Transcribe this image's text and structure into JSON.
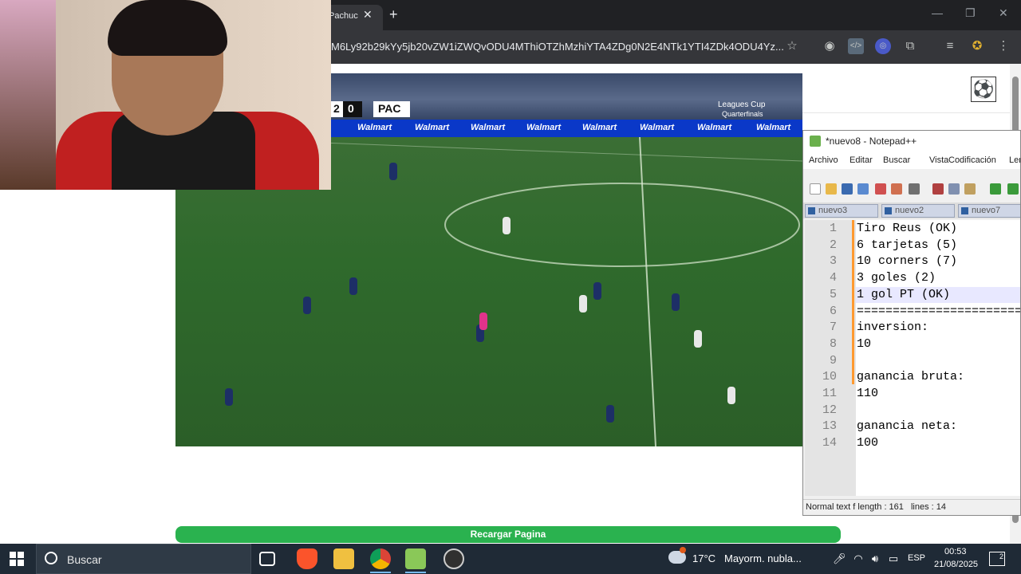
{
  "browser": {
    "tab_title": "Pachuc",
    "url": "M6Ly92b29kYy5jb20vZW1iZWQvODU4MThiOTZhMzhiYTA4ZDg0N2E4NTk1YTI4ZDk4ODU4Yz..."
  },
  "video": {
    "score_left": "2",
    "score_right": "0",
    "team_abbr": "PAC",
    "competition": "Leagues Cup",
    "round": "Quarterfinals",
    "ad_brand": "Walmart"
  },
  "page": {
    "reload_label": "Recargar Pagina"
  },
  "notepad": {
    "title": "*nuevo8 - Notepad++",
    "menu": [
      "Archivo",
      "Editar",
      "Buscar",
      "Vista",
      "Codificación",
      "Len"
    ],
    "tabs": [
      "nuevo3",
      "nuevo2",
      "nuevo7"
    ],
    "lines": [
      "Tiro Reus (OK)",
      "6 tarjetas (5)",
      "10 corners (7)",
      "3 goles (2)",
      "1 gol PT (OK)",
      "=========================",
      "inversion:",
      "10",
      "",
      "ganancia bruta:",
      "110",
      "",
      "ganancia neta:",
      "100"
    ],
    "line_numbers": [
      "1",
      "2",
      "3",
      "4",
      "5",
      "6",
      "7",
      "8",
      "9",
      "10",
      "11",
      "12",
      "13",
      "14"
    ],
    "status_type": "Normal text f",
    "status_length": "length : 161",
    "status_lines": "lines : 14"
  },
  "taskbar": {
    "search_placeholder": "Buscar",
    "weather_temp": "17°C",
    "weather_desc": "Mayorm. nubla...",
    "language": "ESP",
    "time": "00:53",
    "date": "21/08/2025",
    "notifications": "2"
  }
}
